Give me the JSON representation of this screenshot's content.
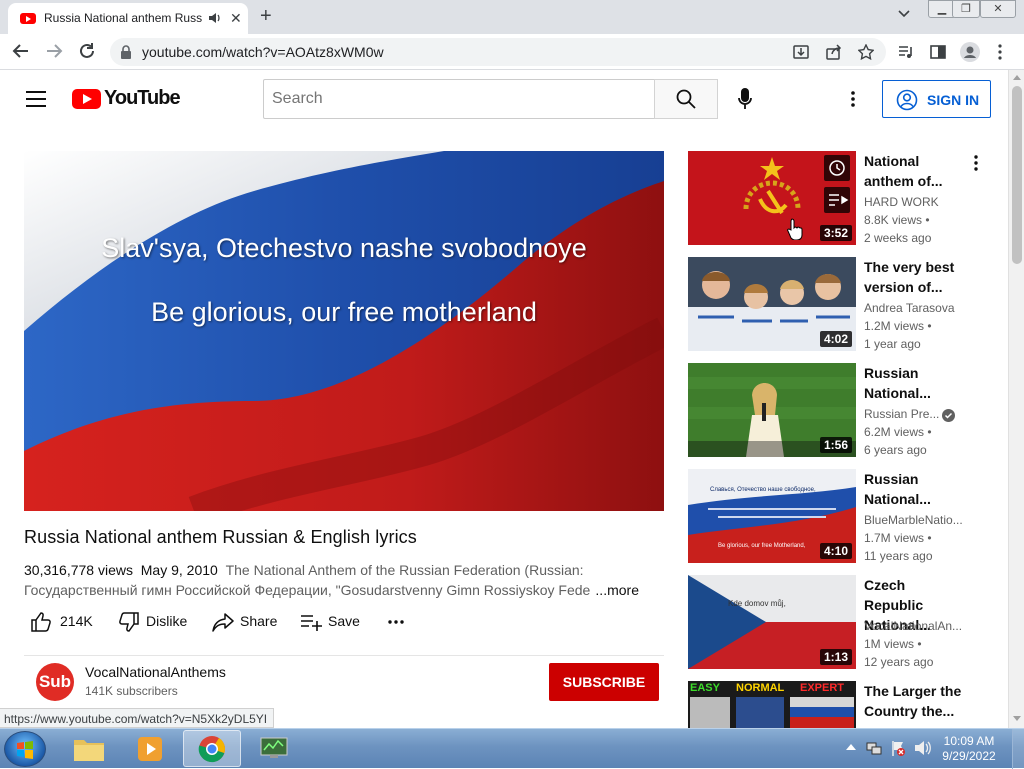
{
  "browser": {
    "tab_title": "Russia National anthem Russ",
    "url": "youtube.com/watch?v=AOAtz8xWM0w",
    "status_url": "https://www.youtube.com/watch?v=N5Xk2yDL5YI"
  },
  "masthead": {
    "logo_text": "YouTube",
    "search_placeholder": "Search",
    "signin_label": "SIGN IN"
  },
  "player": {
    "lyric_line_1": "Slav'sya, Otechestvo nashe svobodnoye",
    "lyric_line_2": "Be glorious, our free motherland"
  },
  "video": {
    "title": "Russia National anthem Russian & English lyrics",
    "views": "30,316,778 views",
    "date": "May 9, 2010",
    "description": "The National Anthem of the Russian Federation (Russian: Государственный гимн Российской Федерации, \"Gosudarstvenny Gimn Rossiyskoy Federatsii\")",
    "more_label": "...more",
    "likes": "214K",
    "dislike_label": "Dislike",
    "share_label": "Share",
    "save_label": "Save"
  },
  "channel": {
    "avatar_text": "Sub",
    "name": "VocalNationalAnthems",
    "subscribers": "141K subscribers",
    "subscribe_label": "SUBSCRIBE"
  },
  "recommendations": [
    {
      "title": "National anthem of...",
      "channel": "HARD WORK",
      "views": "8.8K views •",
      "age": "2 weeks ago",
      "duration": "3:52",
      "verified": false
    },
    {
      "title": "The very best version of...",
      "channel": "Andrea Tarasova",
      "views": "1.2M views •",
      "age": "1 year ago",
      "duration": "4:02",
      "verified": false
    },
    {
      "title": "Russian National...",
      "channel": "Russian Pre...",
      "views": "6.2M views •",
      "age": "6 years ago",
      "duration": "1:56",
      "verified": true
    },
    {
      "title": "Russian National...",
      "channel": "BlueMarbleNatio...",
      "views": "1.7M views •",
      "age": "11 years ago",
      "duration": "4:10",
      "verified": false
    },
    {
      "title": "Czech Republic National...",
      "channel": "VocalNationalAn...",
      "views": "1M views •",
      "age": "12 years ago",
      "duration": "1:13",
      "verified": false
    },
    {
      "title": "The Larger the Country the...",
      "channel": "",
      "views": "",
      "age": "",
      "duration": "",
      "verified": false
    }
  ],
  "thumb_overlays": {
    "thumb4_line1": "Славься, Отечество наше свободное,",
    "thumb4_line2": "Be glorious, our free Motherland,",
    "thumb5_line1": "Kde domov můj,",
    "thumb6_labels": [
      "EASY",
      "NORMAL",
      "EXPERT"
    ]
  },
  "taskbar": {
    "time": "10:09 AM",
    "date": "9/29/2022"
  },
  "colors": {
    "youtube_red": "#ff0000",
    "subscribe_red": "#cc0000",
    "link_blue": "#065fd4"
  }
}
